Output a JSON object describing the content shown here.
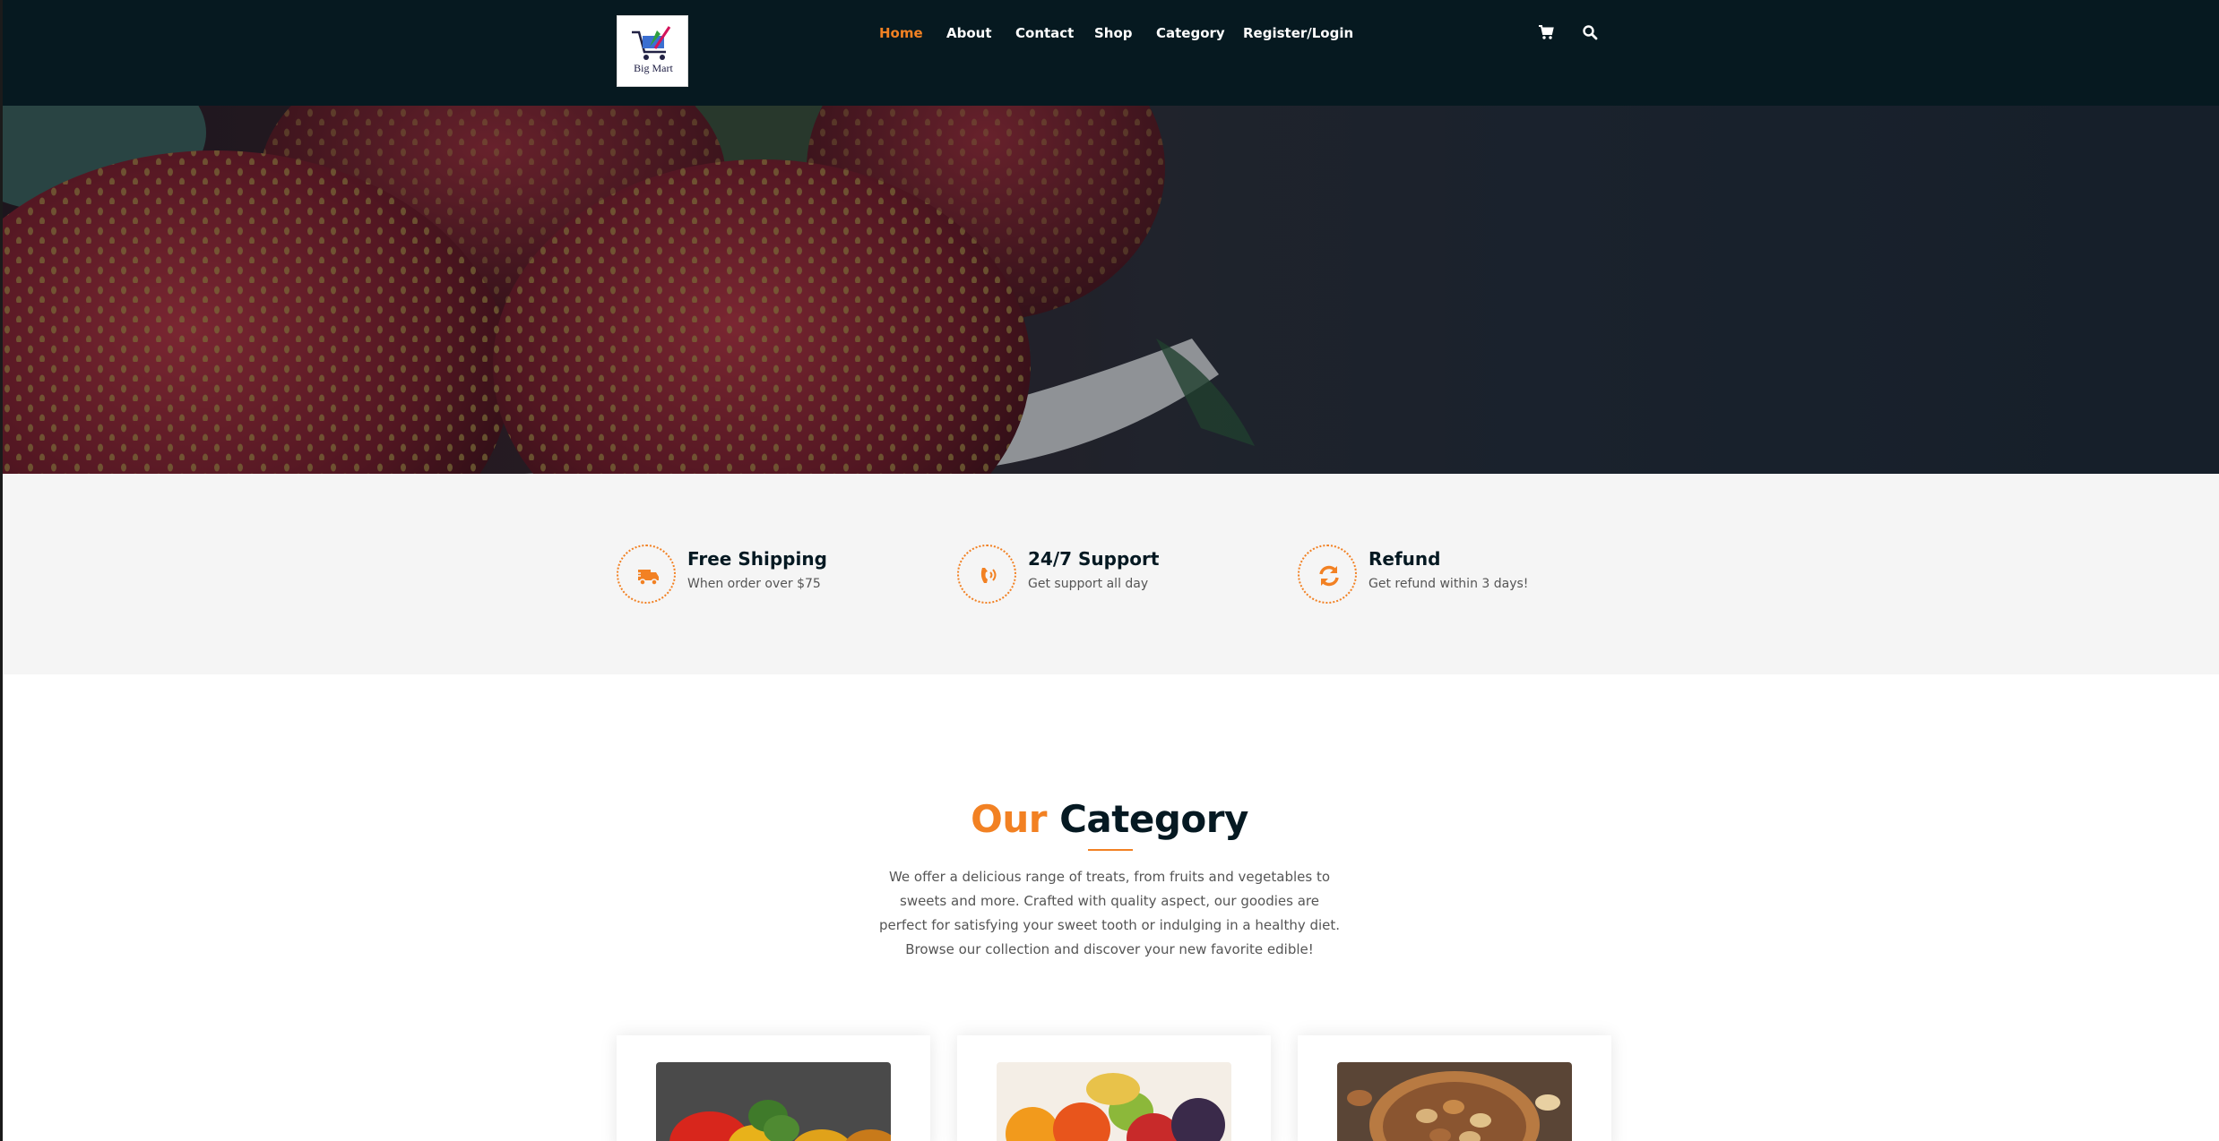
{
  "brand": {
    "logo_text": "Big Mart",
    "accent_color": "#f28123",
    "dark_color": "#061920"
  },
  "nav": {
    "items": [
      {
        "label": "Home",
        "active": true
      },
      {
        "label": "About"
      },
      {
        "label": "Contact"
      },
      {
        "label": "Shop"
      },
      {
        "label": "Category"
      },
      {
        "label": "Register/Login"
      }
    ],
    "icons": [
      "cart-icon",
      "search-icon"
    ]
  },
  "hero": {
    "image": "strawberries-in-bowl"
  },
  "features": [
    {
      "icon": "truck-icon",
      "title": "Free Shipping",
      "subtitle": "When order over $75"
    },
    {
      "icon": "phone-icon",
      "title": "24/7 Support",
      "subtitle": "Get support all day"
    },
    {
      "icon": "refresh-icon",
      "title": "Refund",
      "subtitle": "Get refund within 3 days!"
    }
  ],
  "category_section": {
    "title_accent": "Our",
    "title_main": "Category",
    "description": "We offer a delicious range of treats, from fruits and vegetables to sweets and more. Crafted with quality aspect, our goodies are perfect for satisfying your sweet tooth or indulging in a healthy diet. Browse our collection and discover your new favorite edible!",
    "cards": [
      {
        "image": "vegetables"
      },
      {
        "image": "fruits"
      },
      {
        "image": "nuts"
      }
    ]
  }
}
